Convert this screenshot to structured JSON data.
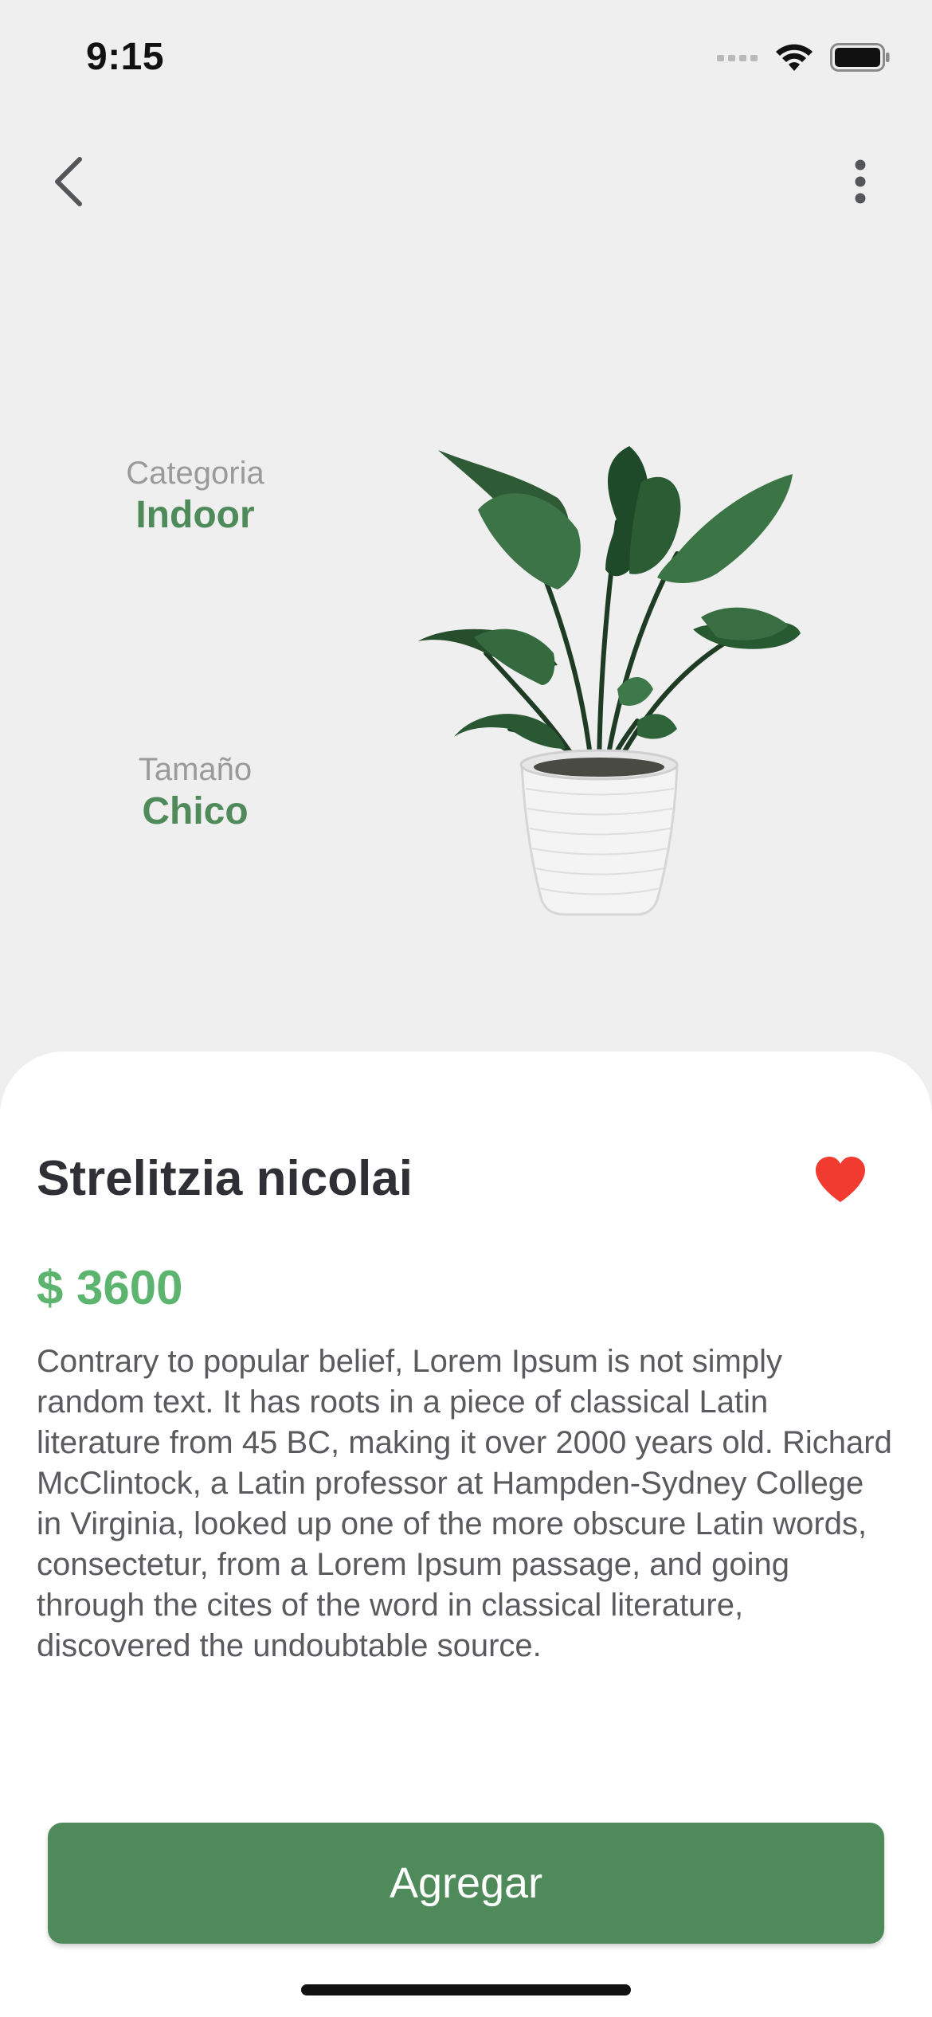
{
  "status_bar": {
    "time": "9:15",
    "icons": [
      "signal-icon",
      "wifi-icon",
      "battery-icon"
    ]
  },
  "nav": {
    "back_icon": "chevron-left-icon",
    "more_icon": "more-vertical-icon"
  },
  "info": {
    "category_label": "Categoria",
    "category_value": "Indoor",
    "size_label": "Tamaño",
    "size_value": "Chico"
  },
  "product": {
    "name": "Strelitzia nicolai",
    "price": "$ 3600",
    "favorite": true,
    "favorite_icon": "heart-icon",
    "description": "Contrary to popular belief, Lorem Ipsum is not simply random text. It has roots in a piece of classical Latin literature from 45 BC, making it over 2000 years old. Richard McClintock, a Latin professor at Hampden-Sydney College in Virginia, looked up one of the more obscure Latin words, consectetur, from a Lorem Ipsum passage, and going through the cites of the word in classical literature, discovered the undoubtable source."
  },
  "actions": {
    "add_label": "Agregar"
  },
  "colors": {
    "background": "#efefef",
    "accent_green": "#4e8a5a",
    "price_green": "#5cb46e",
    "heart_red": "#f23b30",
    "title_dark": "#2f3035"
  }
}
